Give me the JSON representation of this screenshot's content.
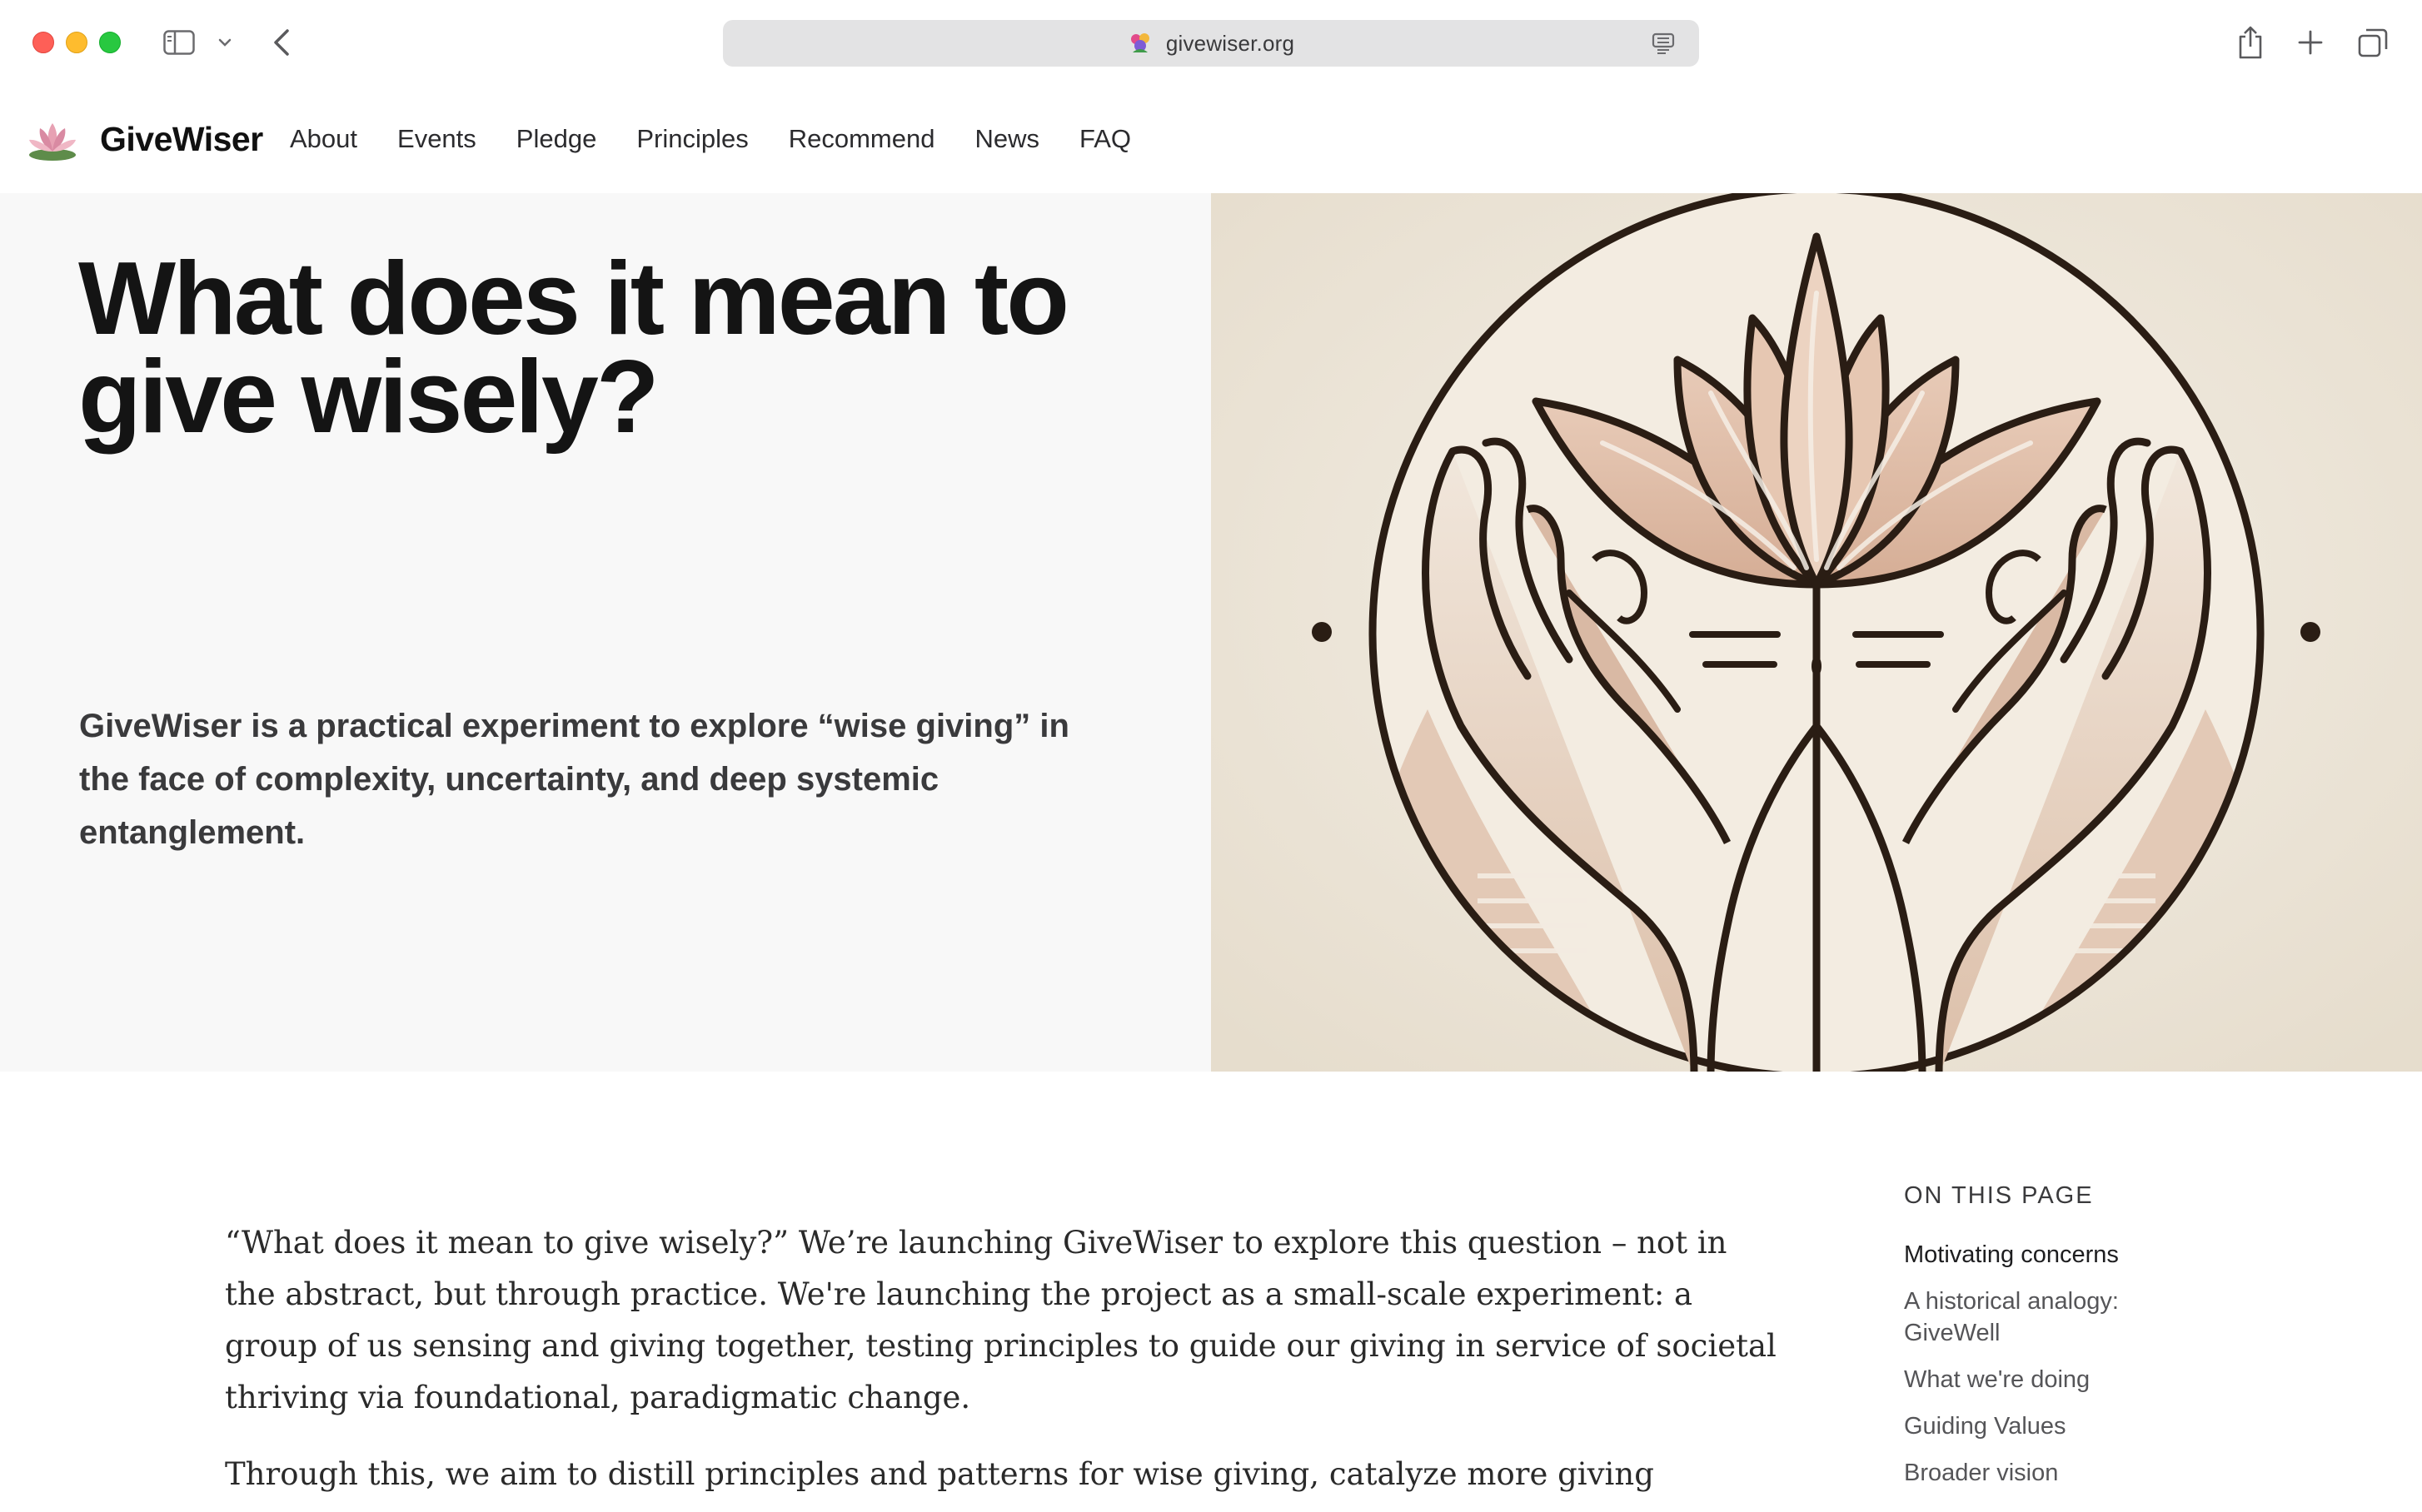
{
  "browser": {
    "url": "givewiser.org"
  },
  "site": {
    "brand": "GiveWiser",
    "nav": [
      "About",
      "Events",
      "Pledge",
      "Principles",
      "Recommend",
      "News",
      "FAQ"
    ]
  },
  "hero": {
    "title": "What does it mean to give wisely?",
    "subtitle": "GiveWiser is a practical experiment to explore “wise giving” in the face of complexity, uncertainty, and deep systemic entanglement."
  },
  "article": {
    "paragraphs": [
      "“What does it mean to give wisely?” We’re launching GiveWiser to explore this question – not in the abstract, but through practice. We're launching the project as a small-scale experiment: a group of us sensing and giving together, testing principles to guide our giving in service of societal thriving via foundational, paradigmatic change.",
      "Through this, we aim to distill principles and patterns for wise giving, catalyze more giving directed toward"
    ]
  },
  "toc": {
    "heading": "ON THIS PAGE",
    "items": [
      "Motivating concerns",
      "A historical analogy: GiveWell",
      "What we're doing",
      "Guiding Values",
      "Broader vision"
    ]
  },
  "colors": {
    "hero_bg": "#f8f8f8",
    "illustration_bg": "#ece5d8",
    "illustration_ink": "#2a1d14",
    "illustration_petal": "#d9b8a2"
  }
}
